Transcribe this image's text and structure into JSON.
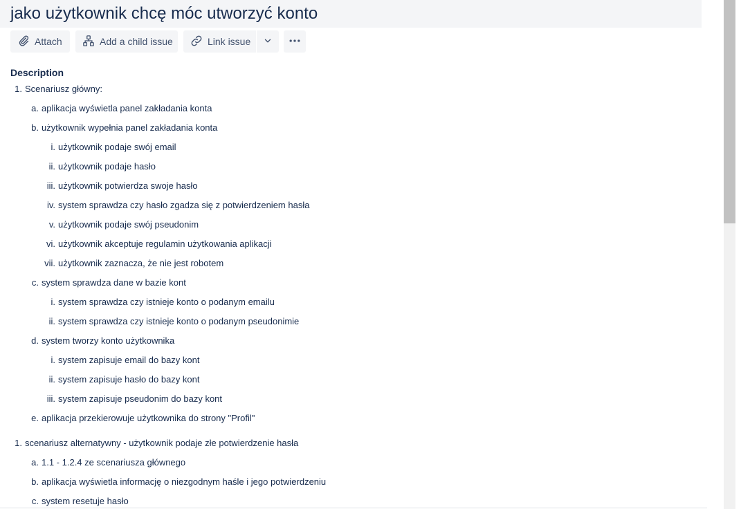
{
  "issue": {
    "title": "jako użytkownik chcę móc utworzyć konto"
  },
  "toolbar": {
    "attach_label": "Attach",
    "child_label": "Add a child issue",
    "link_label": "Link issue",
    "attach_icon": "paperclip-icon",
    "child_icon": "hierarchy-icon",
    "link_icon": "link-icon",
    "dropdown_icon": "chevron-down-icon",
    "more_icon": "more-horizontal-icon"
  },
  "description": {
    "heading": "Description",
    "lines": [
      {
        "marker": "1.",
        "text": "Scenariusz główny:",
        "level": 1
      },
      {
        "marker": "a.",
        "text": "aplikacja wyświetla panel zakładania konta",
        "level": 2
      },
      {
        "marker": "b.",
        "text": "użytkownik wypełnia panel zakładania konta",
        "level": 2
      },
      {
        "marker": "i.",
        "text": "użytkownik podaje swój email",
        "level": 3
      },
      {
        "marker": "ii.",
        "text": "użytkownik podaje hasło",
        "level": 3
      },
      {
        "marker": "iii.",
        "text": "użytkownik potwierdza swoje hasło",
        "level": 3
      },
      {
        "marker": "iv.",
        "text": "system sprawdza czy hasło zgadza się z potwierdzeniem hasła",
        "level": 3
      },
      {
        "marker": "v.",
        "text": "użytkownik podaje swój pseudonim",
        "level": 3
      },
      {
        "marker": "vi.",
        "text": "użytkownik akceptuje regulamin użytkowania aplikacji",
        "level": 3
      },
      {
        "marker": "vii.",
        "text": "użytkownik zaznacza, że nie jest robotem",
        "level": 3
      },
      {
        "marker": "c.",
        "text": "system sprawdza dane w bazie kont",
        "level": 2
      },
      {
        "marker": "i.",
        "text": "system sprawdza czy istnieje konto o podanym emailu",
        "level": 3
      },
      {
        "marker": "ii.",
        "text": "system sprawdza czy istnieje konto o podanym pseudonimie",
        "level": 3
      },
      {
        "marker": "d.",
        "text": "system tworzy konto użytkownika",
        "level": 2
      },
      {
        "marker": "i.",
        "text": "system zapisuje email do bazy kont",
        "level": 3
      },
      {
        "marker": "ii.",
        "text": "system zapisuje hasło do bazy kont",
        "level": 3
      },
      {
        "marker": "iii.",
        "text": "system zapisuje pseudonim do bazy kont",
        "level": 3
      },
      {
        "marker": "e.",
        "text": "aplikacja przekierowuje użytkownika do strony \"Profil\"",
        "level": 2
      },
      {
        "marker": "1.",
        "text": "scenariusz alternatywny - użytkownik podaje złe potwierdzenie hasła",
        "level": 1
      },
      {
        "marker": "a.",
        "text": "1.1 - 1.2.4 ze scenariusza głównego",
        "level": 2
      },
      {
        "marker": "b.",
        "text": "aplikacja wyświetla informację o niezgodnym haśle i jego potwierdzeniu",
        "level": 2
      },
      {
        "marker": "c.",
        "text": "system resetuje hasło",
        "level": 2
      }
    ]
  }
}
